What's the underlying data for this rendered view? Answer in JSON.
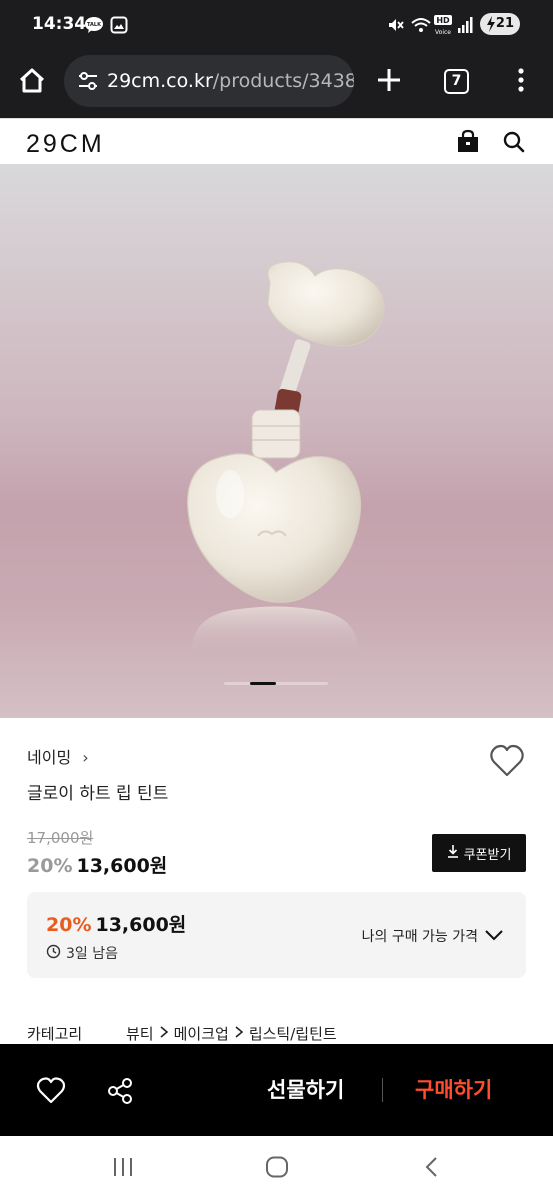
{
  "status_bar": {
    "time": "14:34",
    "notification_icons": [
      "kakaotalk-icon",
      "gallery-icon"
    ],
    "system_icons": [
      "mute-icon",
      "wifi-icon",
      "hd-voice-icon",
      "signal-icon"
    ],
    "hd_label": "HD",
    "voice_label": "Voice",
    "battery_level": "21"
  },
  "browser": {
    "url_domain": "29cm.co.kr",
    "url_path": "/products/3438",
    "tab_count": "7"
  },
  "site": {
    "logo": "29CM"
  },
  "carousel": {
    "slide_count": 4,
    "active_index": 1
  },
  "product": {
    "brand": "네이밍",
    "brand_chevron": "›",
    "title": "글로이 하트 립 틴트",
    "original_price": "17,000원",
    "discount_pct": "20%",
    "sale_price": "13,600원",
    "coupon_label": "쿠폰받기"
  },
  "my_price": {
    "discount_pct": "20%",
    "price": "13,600원",
    "remaining": "3일 남음",
    "label": "나의 구매 가능 가격"
  },
  "category": {
    "label": "카테고리",
    "path": [
      "뷰티",
      "메이크업",
      "립스틱/립틴트"
    ]
  },
  "action_bar": {
    "gift_label": "선물하기",
    "buy_label": "구매하기"
  },
  "colors": {
    "accent_orange": "#e85c1e",
    "buy_red": "#ff4d2e",
    "dark": "#111111"
  }
}
